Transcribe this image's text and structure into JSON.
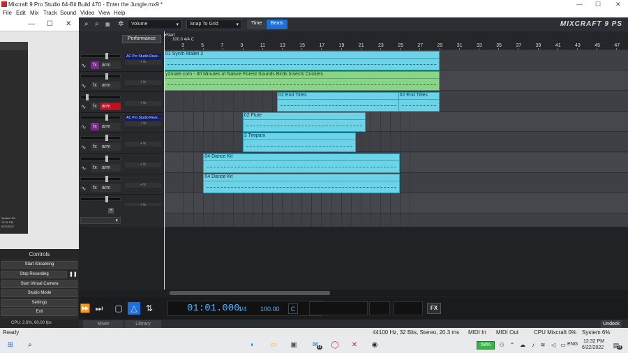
{
  "window": {
    "title": "Mixcraft 9 Pro Studio 64-Bit Build 470 - Enter the Jungle.mx9 *",
    "min": "—",
    "max": "☐",
    "close": "✕"
  },
  "menu": [
    "File",
    "Edit",
    "Mix",
    "Track",
    "Sound",
    "Video",
    "View",
    "Help"
  ],
  "obs": {
    "window_controls": [
      "—",
      "☐",
      "✕"
    ],
    "preview_clock": "12:32 PM",
    "preview_date": "6/22/2022",
    "preview_status": "System 6%",
    "controls_title": "Controls",
    "buttons": [
      "Start Streaming",
      "Stop Recording",
      "Start Virtual Camera",
      "Studio Mode",
      "Settings",
      "Exit"
    ],
    "pause": "❚❚",
    "cpu": "CPU: 2.6%, 60.00 fps"
  },
  "toolbar": {
    "mode": "Volume",
    "snap": "Snap To Grid",
    "time_label": "Time",
    "beats_label": "Beats",
    "brand": "MIXCRAFT 9 PS",
    "icons": [
      "zoom-in",
      "zoom-out",
      "midi",
      "gear"
    ]
  },
  "tracks": {
    "performance_label": "Performance",
    "rows": [
      {
        "plug": "AC Pro Studio Reve...",
        "plugfx": "+ fx",
        "arm": "arm",
        "arm_on": false,
        "fx": "fx",
        "fx_color": "#7a2a8a"
      },
      {
        "plug": "",
        "plugfx": "+ fx",
        "arm": "arm",
        "arm_on": false,
        "fx": "fx",
        "fx_color": "#333"
      },
      {
        "plug": "",
        "plugfx": "+ fx",
        "arm": "arm",
        "arm_on": true,
        "fx": "fx",
        "fx_color": "#333"
      },
      {
        "plug": "AC Pro Studio Reve...",
        "plugfx": "+ fx",
        "arm": "arm",
        "arm_on": false,
        "fx": "fx",
        "fx_color": "#7a2a8a"
      },
      {
        "plug": "",
        "plugfx": "+ fx",
        "arm": "arm",
        "arm_on": false,
        "fx": "fx",
        "fx_color": "#333"
      },
      {
        "plug": "",
        "plugfx": "+ fx",
        "arm": "arm",
        "arm_on": false,
        "fx": "fx",
        "fx_color": "#333"
      },
      {
        "plug": "",
        "plugfx": "+ fx",
        "arm": "arm",
        "arm_on": false,
        "fx": "fx",
        "fx_color": "#333"
      },
      {
        "plug": "",
        "plugfx": "+ fx",
        "arm": "",
        "arm_on": false,
        "fx": "",
        "fx_color": "#27292c"
      }
    ]
  },
  "ruler": {
    "start_label": "Start",
    "tempo_label": "100.0 4/4 C",
    "numbers": [
      "3",
      "5",
      "7",
      "9",
      "11",
      "13",
      "15",
      "17",
      "19",
      "21",
      "23",
      "25",
      "27",
      "29",
      "31",
      "33",
      "35",
      "37",
      "39",
      "41",
      "43",
      "45",
      "47"
    ]
  },
  "clips": [
    {
      "name": "01 Synth Mallet 2",
      "lane": 0,
      "start": 1,
      "end": 29,
      "color": "cyan"
    },
    {
      "name": "y2mate.com - 30 Minutes of Nature Forest Sounds  Birds Insects Crickets",
      "lane": 1,
      "start": 1,
      "end": 29,
      "color": "green"
    },
    {
      "name": "02 End Titles",
      "lane": 2,
      "start": 12.5,
      "end": 25,
      "color": "cyan"
    },
    {
      "name": "02 End Titles",
      "lane": 2,
      "start": 24.8,
      "end": 29,
      "color": "cyan"
    },
    {
      "name": "02 Flute",
      "lane": 3,
      "start": 9,
      "end": 21.5,
      "color": "cyan"
    },
    {
      "name": "3 Timpani",
      "lane": 4,
      "start": 9,
      "end": 20.5,
      "color": "cyan"
    },
    {
      "name": "04 Dance Kit",
      "lane": 5,
      "start": 5,
      "end": 25,
      "color": "cyan"
    },
    {
      "name": "04 Dance Kit",
      "lane": 6,
      "start": 5,
      "end": 25,
      "color": "cyan"
    }
  ],
  "transport": {
    "time": "01:01.000",
    "time_sig": "4/4",
    "bpm": "100.00",
    "key": "C",
    "fx": "FX"
  },
  "bottom_tabs": {
    "mixer": "Mixer",
    "library": "Library",
    "undock": "Undock"
  },
  "status": {
    "left": "Ready",
    "audio": "44100 Hz, 32 Bits, Stereo, 20.3 ms",
    "midi_in": "MIDI In",
    "midi_out": "MIDI Out",
    "cpu": "CPU Mixcraft 0%",
    "system": "System 6%"
  },
  "taskbar": {
    "battery": "58%",
    "lang": "ENG",
    "time": "12:32 PM",
    "date": "6/22/2022",
    "notif": "24",
    "mail_badge": "14"
  }
}
